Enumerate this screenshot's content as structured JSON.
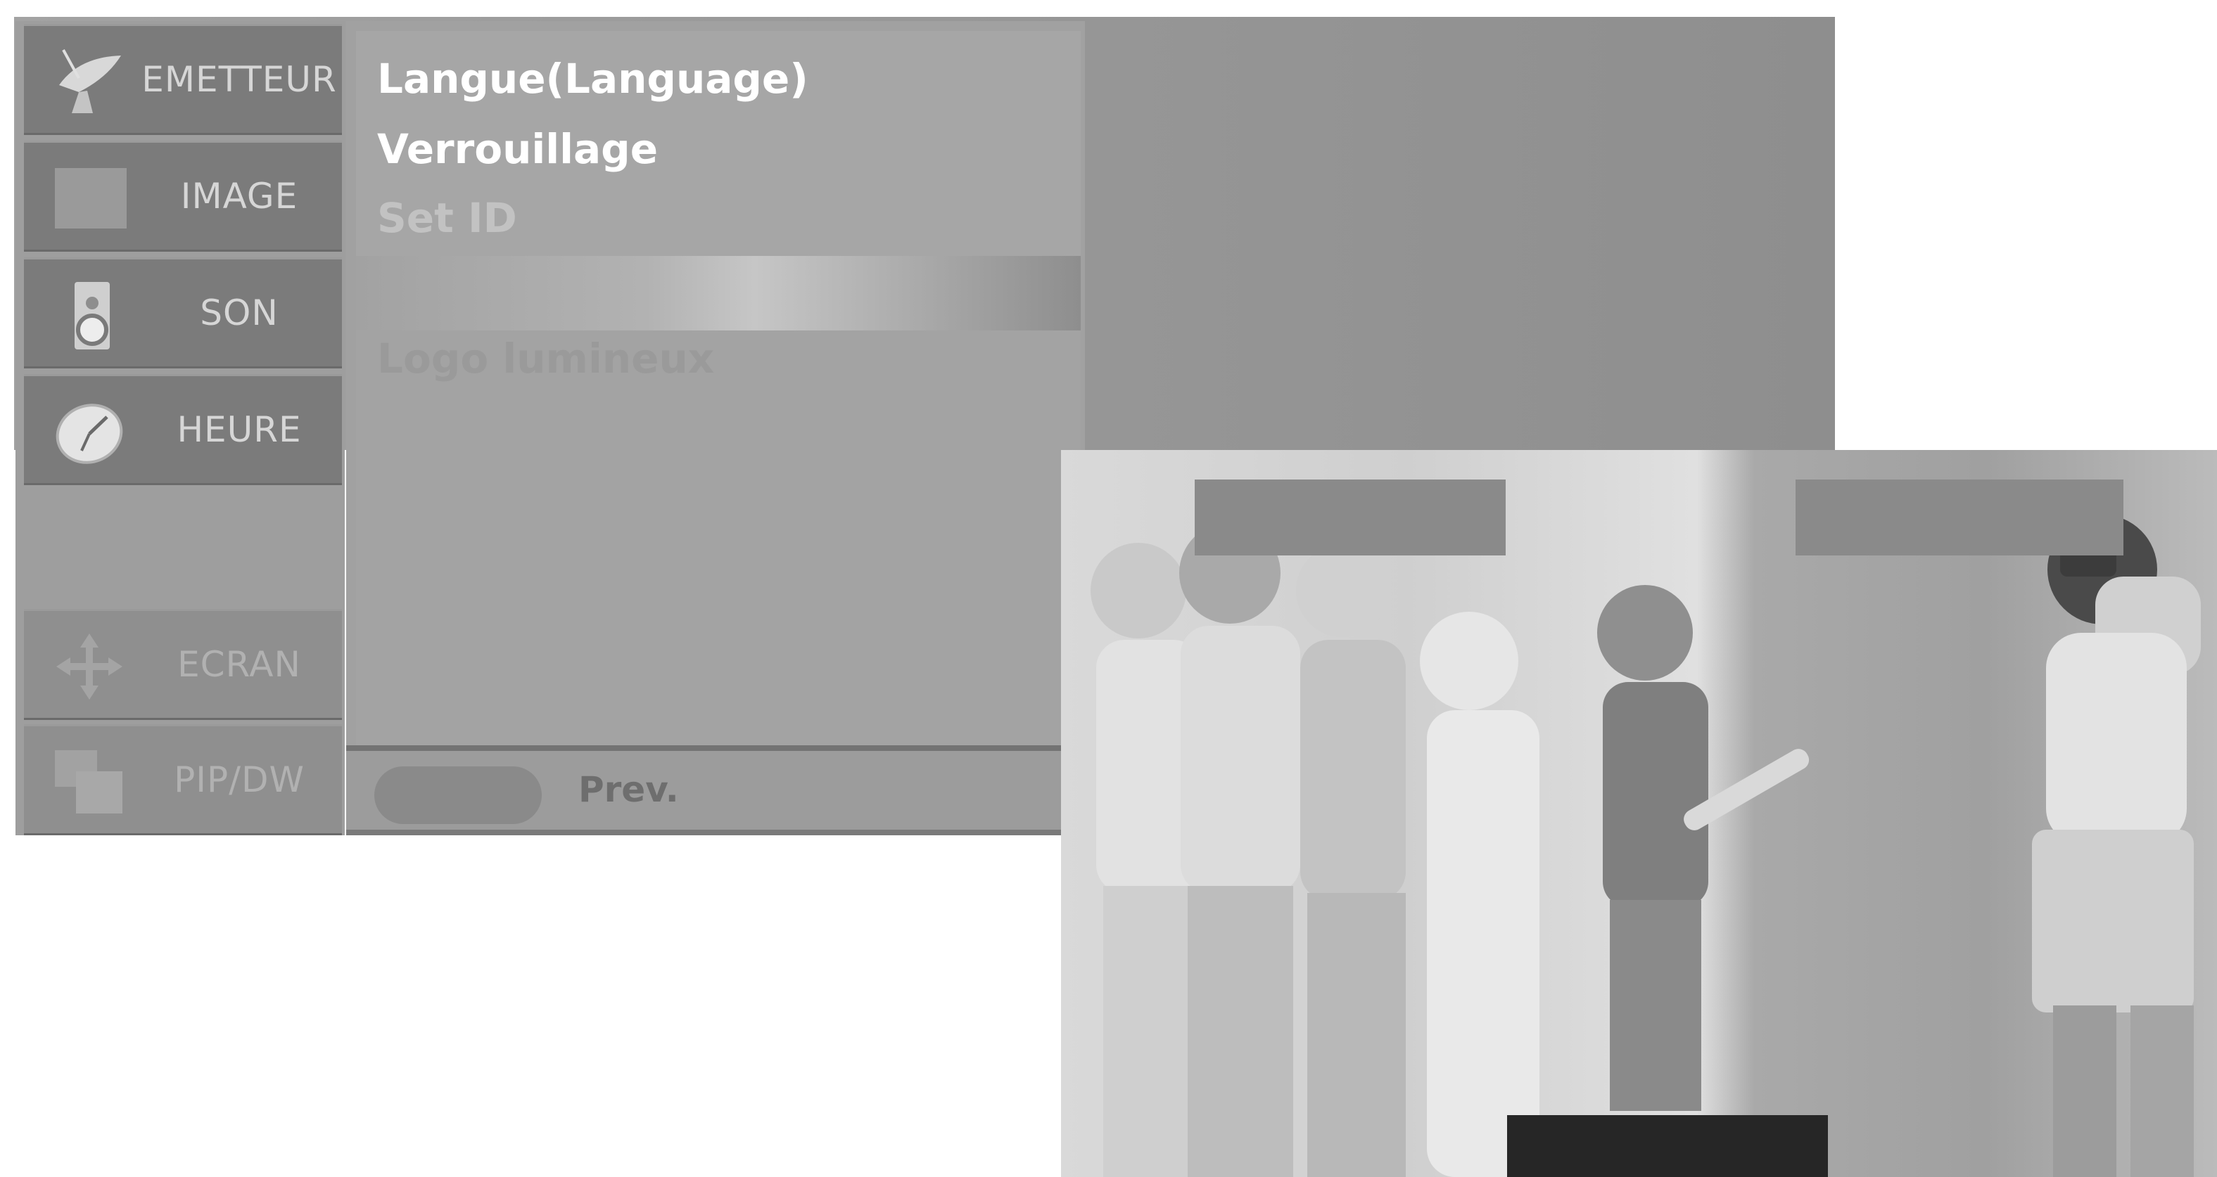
{
  "sidebar": {
    "items": [
      {
        "label": "EMETTEUR",
        "icon": "satellite-dish-icon"
      },
      {
        "label": "IMAGE",
        "icon": "picture-square-icon"
      },
      {
        "label": "SON",
        "icon": "speaker-icon"
      },
      {
        "label": "HEURE",
        "icon": "clock-icon"
      },
      {
        "label": "ECRAN",
        "icon": "move-arrows-icon"
      },
      {
        "label": "PIP/DW",
        "icon": "pip-windows-icon"
      }
    ]
  },
  "menu": {
    "items": [
      {
        "label": "Langue(Language)"
      },
      {
        "label": "Verrouillage"
      },
      {
        "label": "Set ID"
      },
      {
        "label": "Logo lumineux"
      }
    ]
  },
  "footer": {
    "prev_label": "Prev."
  }
}
